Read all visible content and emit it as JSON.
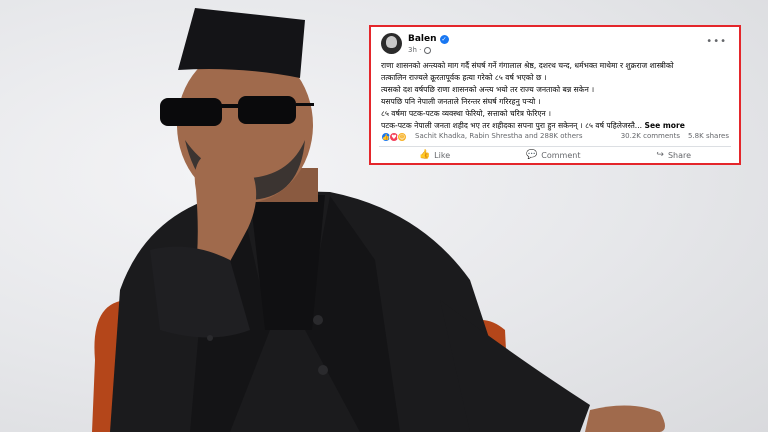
{
  "post": {
    "author": "Balen",
    "time": "3h ·",
    "lines": [
      "राणा शासनको अन्त्यको माग गर्दै संघर्ष गर्ने गंगालाल श्रेष्ठ, दशरथ चन्द, धर्मभक्त माथेमा र शुक्रराज शास्त्रीको",
      "तत्कालिन राज्यले क्रूरतापूर्वक हत्या गरेको ८५ वर्ष भएको छ ।",
      "त्यसको दश वर्षपछि राणा शासनको अन्त्य भयो तर राज्य जनताको बन्न सकेन ।",
      "यसपछि पनि नेपाली जनताले निरन्तर संघर्ष गरिरहनु पर्‍यो ।",
      "८५ वर्षमा पटक-पटक व्यवस्था फेरियो, सत्ताको चरित्र फेरिएन ।",
      "पटक-पटक नेपाली जनता शहीद भए तर शहीदका सपना पुरा हुन सकेनन् । ८५ वर्ष पहिलेजस्तै..."
    ],
    "see_more": "See more",
    "reactors": "Sachit Khadka, Rabin Shrestha and 288K others",
    "comments_count": "30.2K comments",
    "shares_count": "5.8K shares",
    "actions": {
      "like": "Like",
      "comment": "Comment",
      "share": "Share"
    }
  },
  "icons": [
    "verified-icon",
    "globe-icon",
    "more-options-icon",
    "like-reaction-icon",
    "love-reaction-icon",
    "haha-reaction-icon",
    "like-icon",
    "comment-icon",
    "share-icon"
  ],
  "colors": {
    "highlight_border": "#e4262b",
    "facebook_blue": "#1877f2"
  }
}
